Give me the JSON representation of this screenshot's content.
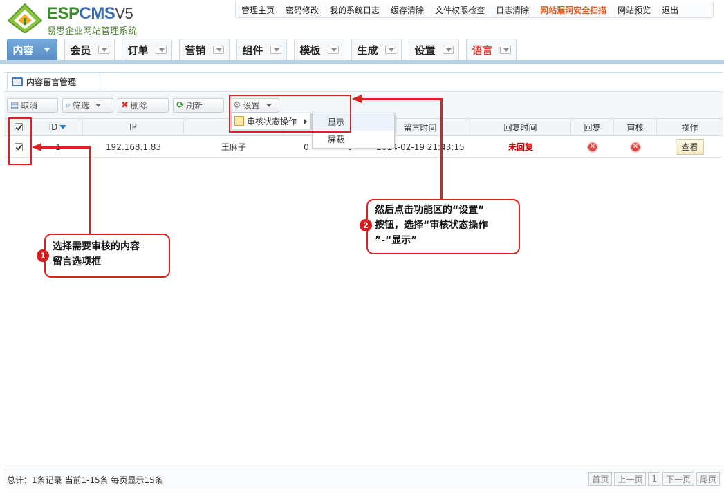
{
  "logo": {
    "brand_esp": "ESP",
    "brand_cms": "CMS",
    "brand_version": "V5",
    "subtitle": "易思企业网站管理系统"
  },
  "top_links": [
    "管理主页",
    "密码修改",
    "我的系统日志",
    "缓存清除",
    "文件权限检查",
    "日志清除",
    "网站漏洞安全扫描",
    "网站预览",
    "退出"
  ],
  "nav": {
    "tabs": [
      {
        "label": "内容",
        "active": true
      },
      {
        "label": "会员"
      },
      {
        "label": "订单"
      },
      {
        "label": "营销"
      },
      {
        "label": "组件"
      },
      {
        "label": "模板"
      },
      {
        "label": "生成"
      },
      {
        "label": "设置"
      },
      {
        "label": "语言",
        "highlight": true
      }
    ]
  },
  "panel": {
    "tab_title": "内容留言管理"
  },
  "toolbar": {
    "cancel": "取消",
    "filter": "筛选",
    "delete": "删除",
    "refresh": "刷新",
    "settings": "设置"
  },
  "grid": {
    "headers": {
      "id": "ID",
      "ip": "IP",
      "name": "",
      "count": "",
      "count2": "",
      "time": "留言时间",
      "reply_time": "回复时间",
      "reply": "回复",
      "audit": "审核",
      "op": "操作"
    },
    "rows": [
      {
        "id": "1",
        "ip": "192.168.1.83",
        "name": "王麻子",
        "count": "0",
        "count2": "0",
        "time": "2014-02-19 21:43:15",
        "reply_time": "未回复",
        "op": "查看"
      }
    ]
  },
  "menu": {
    "item": "审核状态操作",
    "sub_show": "显示",
    "sub_block": "屏蔽"
  },
  "callouts": {
    "one_num": "1",
    "one_text_l1": "选择需要审核的内容",
    "one_text_l2": "留言选项框",
    "two_num": "2",
    "two_text_l1": "然后点击功能区的“设置”",
    "two_text_l2": "按钮，选择“审核状态操作",
    "two_text_l3": "”-“显示”"
  },
  "footer": {
    "stats": "总计：1条记录 当前1-15条 每页显示15条",
    "pager": {
      "first": "首页",
      "prev": "上一页",
      "page": "1",
      "next": "下一页",
      "last": "尾页"
    }
  },
  "colors": {
    "accent": "#e0201e",
    "nav_active": "#5b8fc4",
    "highlight_link": "#e0581b"
  }
}
